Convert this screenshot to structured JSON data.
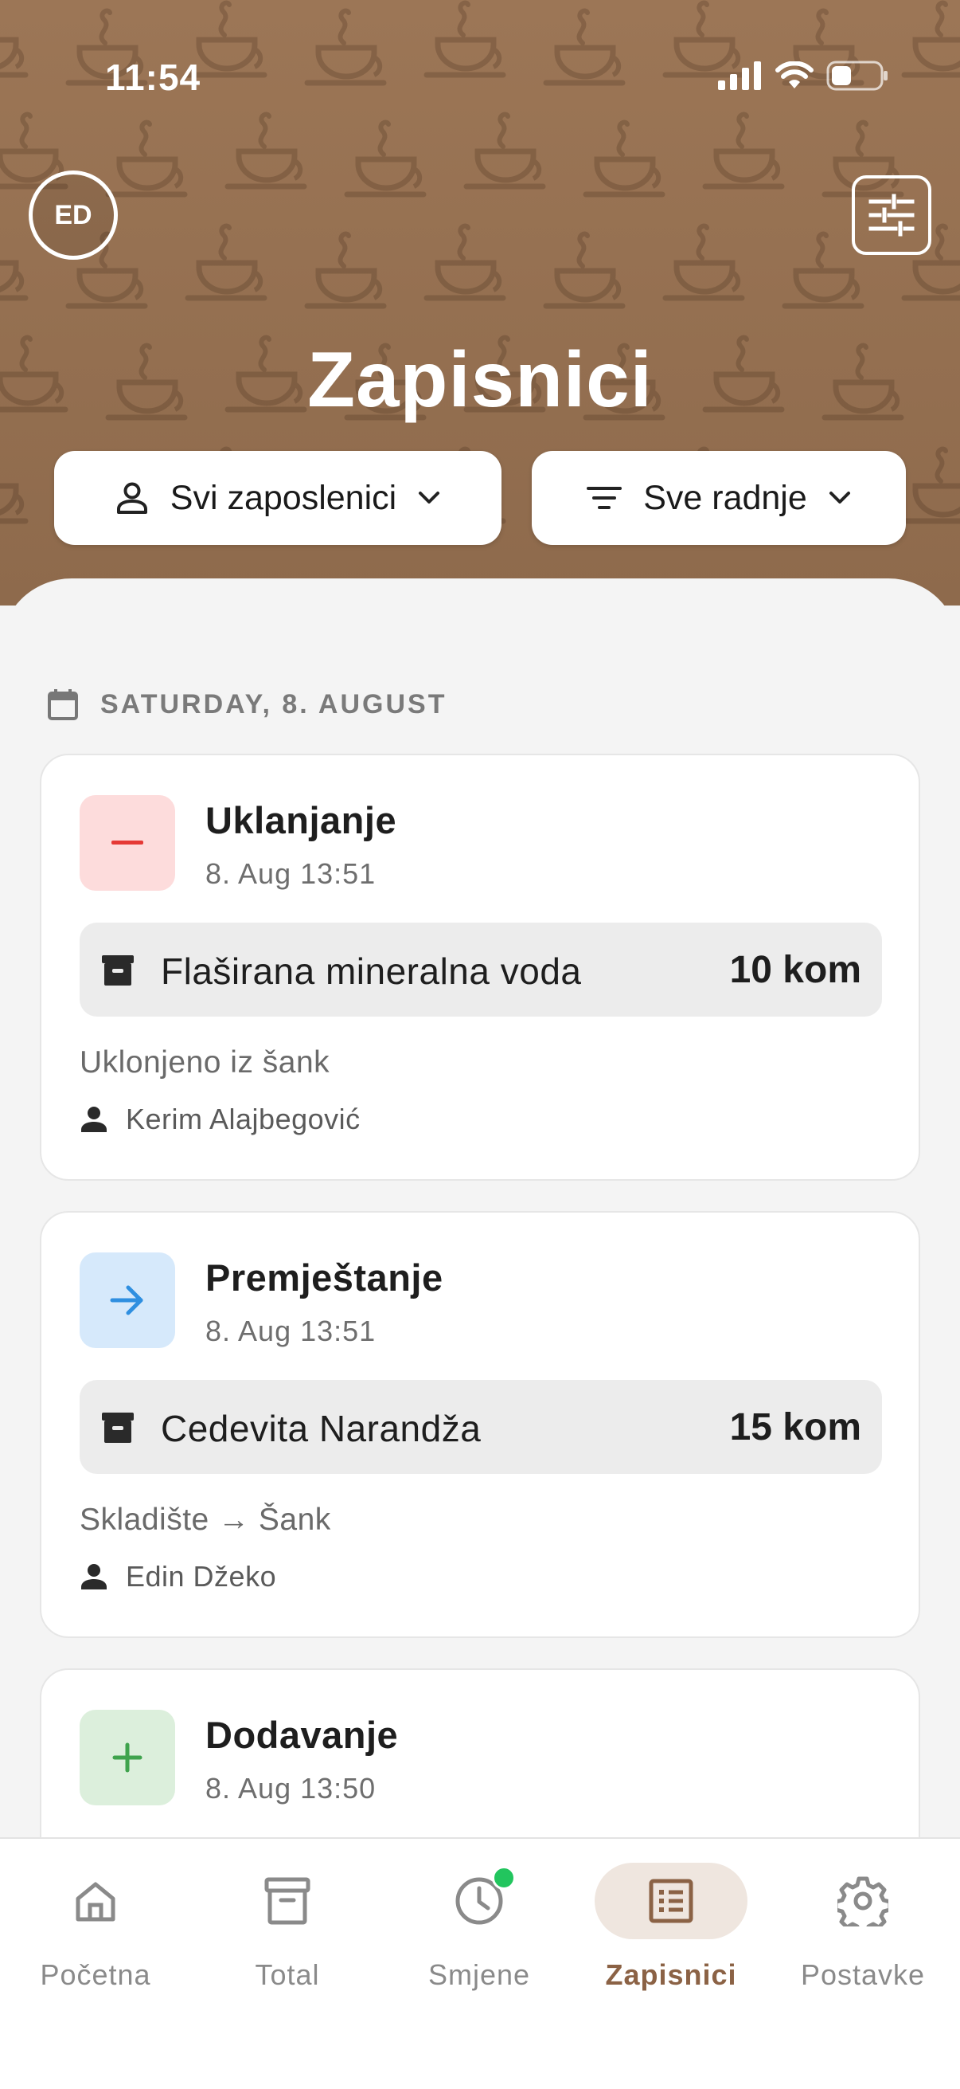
{
  "status_bar": {
    "time": "11:54"
  },
  "header": {
    "avatar_initials": "ED",
    "title": "Zapisnici",
    "filters": {
      "employee_label": "Svi zaposlenici",
      "action_label": "Sve radnje"
    }
  },
  "date_section": {
    "label": "SATURDAY, 8. AUGUST"
  },
  "entries": [
    {
      "type": "Uklanjanje",
      "icon": "minus-icon",
      "badge_color": "#fddcdc",
      "icon_color": "#e53935",
      "time": "8. Aug 13:51",
      "item_name": "Flaširana mineralna voda",
      "quantity": "10 kom",
      "description": "Uklonjeno iz šank",
      "user": "Kerim Alajbegović"
    },
    {
      "type": "Premještanje",
      "icon": "arrow-right-icon",
      "badge_color": "#d6e9fb",
      "icon_color": "#2f8fe0",
      "time": "8. Aug 13:51",
      "item_name": "Cedevita Narandža",
      "quantity": "15 kom",
      "description": "Skladište → Šank",
      "user": "Edin Džeko"
    },
    {
      "type": "Dodavanje",
      "icon": "plus-icon",
      "badge_color": "#dcefdc",
      "icon_color": "#3fa34d",
      "time": "8. Aug 13:50"
    }
  ],
  "bottom_nav": {
    "items": [
      {
        "label": "Početna",
        "icon": "home-icon"
      },
      {
        "label": "Total",
        "icon": "archive-icon"
      },
      {
        "label": "Smjene",
        "icon": "clock-icon"
      },
      {
        "label": "Zapisnici",
        "icon": "list-icon",
        "active": true
      },
      {
        "label": "Postavke",
        "icon": "gear-icon"
      }
    ]
  },
  "colors": {
    "header_brown": "#94704f",
    "accent_brown": "#8b6245",
    "active_nav_bg": "#efe6df",
    "notification_dot": "#22c55e"
  }
}
